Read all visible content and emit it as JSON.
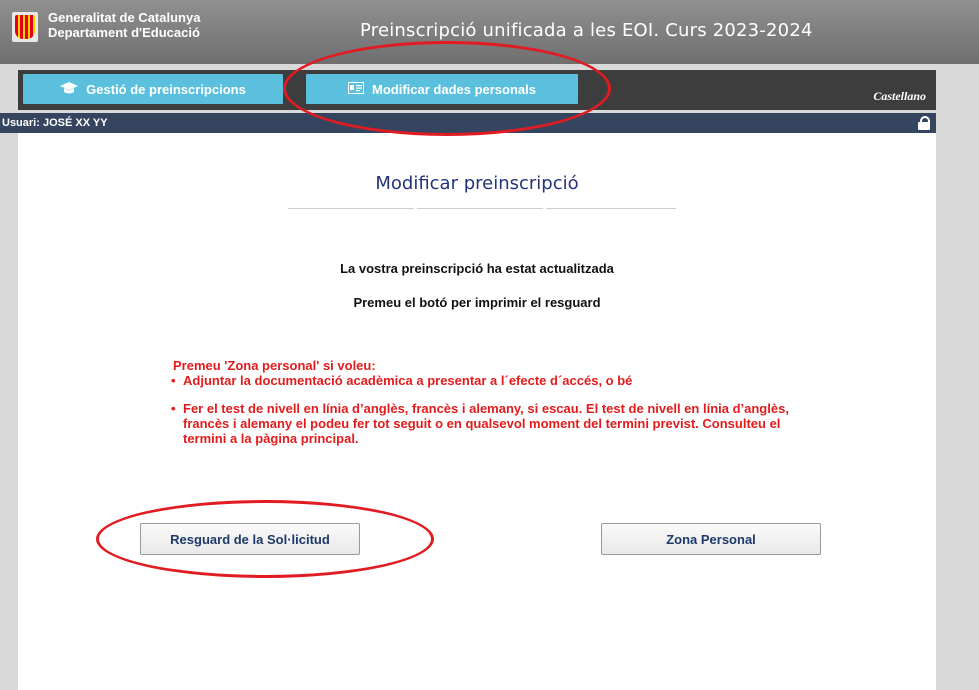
{
  "header": {
    "org_line1": "Generalitat de Catalunya",
    "org_line2": "Departament d'Educació",
    "title": "Preinscripció unificada a les EOI. Curs 2023-2024"
  },
  "nav": {
    "manage_label": "Gestió de preinscripcions",
    "manage_icon": "graduation-cap-icon",
    "modify_label": "Modificar dades personals",
    "modify_icon": "id-card-icon",
    "language_link": "Castellano",
    "button_color": "#5bc0de"
  },
  "userbar": {
    "user_text": "Usuari: JOSÉ XX YY",
    "lock_icon": "lock-icon"
  },
  "main": {
    "title": "Modificar preinscripció",
    "message1": "La vostra preinscripció ha estat actualitzada",
    "message2": "Premeu el botó per imprimir el resguard",
    "notice_heading": "Premeu 'Zona personal' si voleu:",
    "notice_items": [
      "Adjuntar la documentació acadèmica a presentar a l´efecte d´accés, o bé",
      "Fer el test de nivell en línia d’anglès, francès i alemany, si escau. El test de nivell en línia d’anglès, francès i alemany el podeu fer tot seguit o en qualsevol moment del termini previst. Consulteu el termini a la pàgina principal."
    ],
    "receipt_button": "Resguard de la Sol·licitud",
    "personal_zone_button": "Zona Personal"
  },
  "colors": {
    "notice_red": "#e21c1c",
    "title_blue": "#25337a",
    "annotation_red": "#e01b22"
  }
}
